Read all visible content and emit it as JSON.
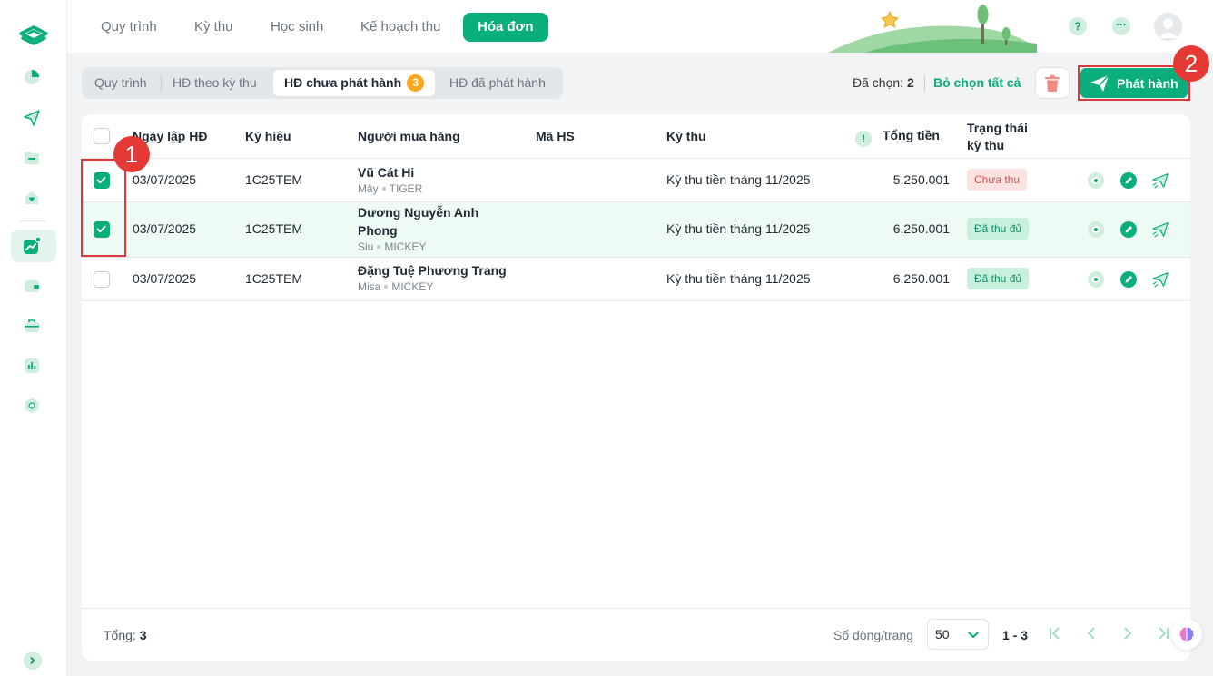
{
  "nav": {
    "items": [
      "Quy trình",
      "Kỳ thu",
      "Học sinh",
      "Kế hoạch thu"
    ],
    "active": "Hóa đơn",
    "help": "?",
    "more": "···"
  },
  "tabs": {
    "items": [
      "Quy trình",
      "HĐ theo kỳ thu"
    ],
    "active": "HĐ chưa phát hành",
    "active_count": "3",
    "last": "HĐ đã phát hành"
  },
  "toolbar": {
    "selected_prefix": "Đã chọn:",
    "selected_count": "2",
    "clear_all": "Bỏ chọn tất cả",
    "publish": "Phát hành"
  },
  "markers": [
    "1",
    "2"
  ],
  "table": {
    "headers": {
      "date": "Ngày lập HĐ",
      "symbol": "Ký hiệu",
      "buyer": "Người mua hàng",
      "student_code": "Mã HS",
      "period": "Kỳ thu",
      "total_info": "!",
      "total": "Tổng tiền",
      "status_1": "Trạng thái",
      "status_2": "kỳ thu"
    },
    "rows": [
      {
        "date": "03/07/2025",
        "symbol": "1C25TEM",
        "buyer_1": "Vũ Cát Hi",
        "buyer_2": "",
        "student_name": "Mây",
        "class": "TIGER",
        "period": "Kỳ thu tiền tháng 11/2025",
        "total": "5.250.001",
        "status": "Chưa thu",
        "checked": true
      },
      {
        "date": "03/07/2025",
        "symbol": "1C25TEM",
        "buyer_1": "Dương Nguyễn Anh",
        "buyer_2": "Phong",
        "student_name": "Siu",
        "class": "MICKEY",
        "period": "Kỳ thu tiền tháng 11/2025",
        "total": "6.250.001",
        "status": "Đã thu đủ",
        "checked": true
      },
      {
        "date": "03/07/2025",
        "symbol": "1C25TEM",
        "buyer_1": "Đặng Tuệ Phương Trang",
        "buyer_2": "",
        "student_name": "Misa",
        "class": "MICKEY",
        "period": "Kỳ thu tiền tháng 11/2025",
        "total": "6.250.001",
        "status": "Đã thu đủ",
        "checked": false
      }
    ]
  },
  "footer": {
    "total_label": "Tổng:",
    "total_value": "3",
    "rows_per_page_label": "Số dòng/trang",
    "rows_per_page": "50",
    "range": "1 - 3"
  },
  "colors": {
    "brand": "#0aae7d",
    "unpaid_bg": "#fde2e2",
    "unpaid_text": "#d9534f",
    "paid_bg": "#c9f0dd",
    "paid_text": "#0a8f66",
    "marker": "#e53935",
    "badge": "#f6a823"
  }
}
